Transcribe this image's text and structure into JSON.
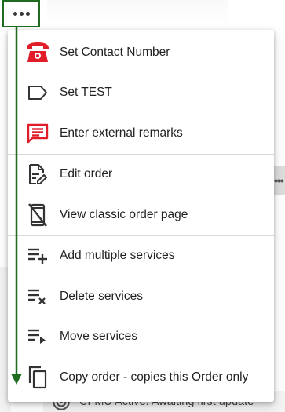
{
  "trigger": {
    "icon": "more-horizontal-icon"
  },
  "menu": {
    "groups": [
      [
        {
          "label": "Set Contact Number",
          "icon": "phone-icon",
          "color": "#e11d2a"
        },
        {
          "label": "Set TEST",
          "icon": "label-tag-icon",
          "color": "#333333"
        },
        {
          "label": "Enter external remarks",
          "icon": "comment-icon",
          "color": "#e11d2a"
        }
      ],
      [
        {
          "label": "Edit order",
          "icon": "edit-document-icon",
          "color": "#333333"
        },
        {
          "label": "View classic order page",
          "icon": "mobile-off-icon",
          "color": "#333333"
        }
      ],
      [
        {
          "label": "Add multiple services",
          "icon": "playlist-add-icon",
          "color": "#333333"
        },
        {
          "label": "Delete services",
          "icon": "playlist-remove-icon",
          "color": "#333333"
        },
        {
          "label": "Move services",
          "icon": "playlist-play-icon",
          "color": "#333333"
        },
        {
          "label": "Copy order - copies this Order only",
          "icon": "copy-icon",
          "color": "#333333"
        }
      ]
    ]
  },
  "background": {
    "status_text": "CFMU Active. Awaiting first update"
  },
  "annotation_color": "#1f6b1f"
}
